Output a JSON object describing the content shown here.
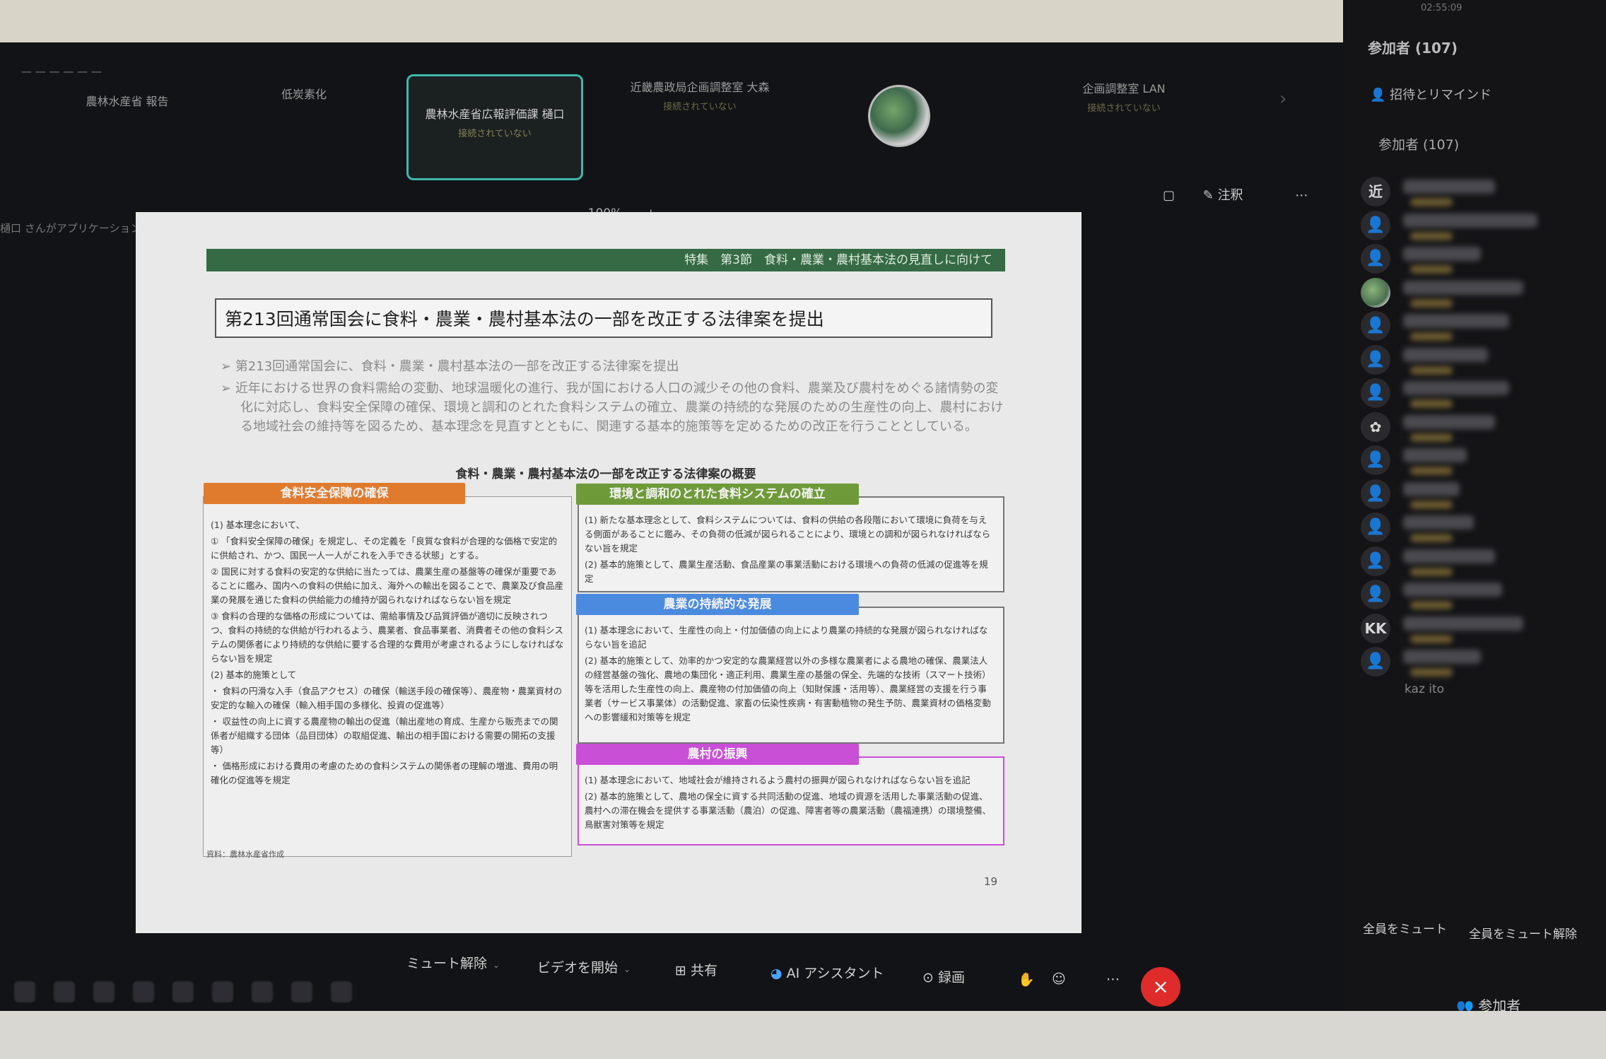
{
  "clock": "02:55:09",
  "gallery": {
    "tiles": [
      {
        "name": "農林水産省 報告",
        "sub": "",
        "active": false
      },
      {
        "name": "低炭素化",
        "sub": "",
        "active": false
      },
      {
        "name": "農林水産省広報評価課 樋口",
        "sub": "接続されていない",
        "active": true
      },
      {
        "name": "近畿農政局企画調整室 大森",
        "sub": "接続されていない",
        "active": false
      },
      {
        "name": "企画調整室 LAN",
        "sub": "接続されていない",
        "active": false
      }
    ]
  },
  "share": {
    "note": "樋口 さんがアプリケーションを共有しています",
    "zoom": "100%",
    "zoom_minus": "−",
    "zoom_plus": "+",
    "annotate": "注釈"
  },
  "slide": {
    "header": "特集　第3節　食料・農業・農村基本法の見直しに向けて",
    "title": "第213回通常国会に食料・農業・農村基本法の一部を改正する法律案を提出",
    "bullets": [
      "第213回通常国会に、食料・農業・農村基本法の一部を改正する法律案を提出",
      "近年における世界の食料需給の変動、地球温暖化の進行、我が国における人口の減少その他の食料、農業及び農村をめぐる諸情勢の変化に対応し、食料安全保障の確保、環境と調和のとれた食料システムの確立、農業の持続的な発展のための生産性の向上、農村における地域社会の維持等を図るため、基本理念を見直すとともに、関連する基本的施策等を定めるための改正を行うこととしている。"
    ],
    "subhead": "食料・農業・農村基本法の一部を改正する法律案の概要",
    "boxes": {
      "food_security": {
        "title": "食料安全保障の確保",
        "color": "#e07b2e",
        "items": [
          "(1) 基本理念において、",
          "① 「食料安全保障の確保」を規定し、その定義を「良質な食料が合理的な価格で安定的に供給され、かつ、国民一人一人がこれを入手できる状態」とする。",
          "② 国民に対する食料の安定的な供給に当たっては、農業生産の基盤等の確保が重要であることに鑑み、国内への食料の供給に加え、海外への輸出を図ることで、農業及び食品産業の発展を通じた食料の供給能力の維持が図られなければならない旨を規定",
          "③ 食料の合理的な価格の形成については、需給事情及び品質評価が適切に反映されつつ、食料の持続的な供給が行われるよう、農業者、食品事業者、消費者その他の食料システムの関係者により持続的な供給に要する合理的な費用が考慮されるようにしなければならない旨を規定",
          "(2) 基本的施策として",
          "・ 食料の円滑な入手（食品アクセス）の確保（輸送手段の確保等）、農産物・農業資材の安定的な輸入の確保（輸入相手国の多様化、投資の促進等）",
          "・ 収益性の向上に資する農産物の輸出の促進（輸出産地の育成、生産から販売までの関係者が組織する団体（品目団体）の取組促進、輸出の相手国における需要の開拓の支援等）",
          "・ 価格形成における費用の考慮のための食料システムの関係者の理解の増進、費用の明確化の促進等を規定"
        ]
      },
      "environment": {
        "title": "環境と調和のとれた食料システムの確立",
        "color": "#6f9a3a",
        "items": [
          "(1) 新たな基本理念として、食料システムについては、食料の供給の各段階において環境に負荷を与える側面があることに鑑み、その負荷の低減が図られることにより、環境との調和が図られなければならない旨を規定",
          "(2) 基本的施策として、農業生産活動、食品産業の事業活動における環境への負荷の低減の促進等を規定"
        ]
      },
      "sustainable": {
        "title": "農業の持続的な発展",
        "color": "#4a8be0",
        "items": [
          "(1) 基本理念において、生産性の向上・付加価値の向上により農業の持続的な発展が図られなければならない旨を追記",
          "(2) 基本的施策として、効率的かつ安定的な農業経営以外の多様な農業者による農地の確保、農業法人の経営基盤の強化、農地の集団化・適正利用、農業生産の基盤の保全、先端的な技術（スマート技術）等を活用した生産性の向上、農産物の付加価値の向上（知財保護・活用等）、農業経営の支援を行う事業者（サービス事業体）の活動促進、家畜の伝染性疾病・有害動植物の発生予防、農業資材の価格変動への影響緩和対策等を規定"
        ]
      },
      "rural": {
        "title": "農村の振興",
        "color": "#c94fd6",
        "items": [
          "(1) 基本理念において、地域社会が維持されるよう農村の振興が図られなければならない旨を追記",
          "(2) 基本的施策として、農地の保全に資する共同活動の促進、地域の資源を活用した事業活動の促進、農村への滞在機会を提供する事業活動（農泊）の促進、障害者等の農業活動（農福連携）の環境整備、鳥獣害対策等を規定"
        ]
      }
    },
    "source": "資料：農林水産省作成",
    "page": "19"
  },
  "participants_panel": {
    "title": "参加者 (107)",
    "invite": "招待とリマインド",
    "section": "参加者 (107)",
    "avatars": [
      {
        "kind": "text",
        "label": "近"
      },
      {
        "kind": "person",
        "label": "👤"
      },
      {
        "kind": "person",
        "label": "👤"
      },
      {
        "kind": "photo",
        "label": ""
      },
      {
        "kind": "person",
        "label": "👤"
      },
      {
        "kind": "person",
        "label": "👤"
      },
      {
        "kind": "person",
        "label": "👤"
      },
      {
        "kind": "text",
        "label": "✿"
      },
      {
        "kind": "person",
        "label": "👤"
      },
      {
        "kind": "person",
        "label": "👤"
      },
      {
        "kind": "person",
        "label": "👤"
      },
      {
        "kind": "person",
        "label": "👤"
      },
      {
        "kind": "person",
        "label": "👤"
      },
      {
        "kind": "text",
        "label": "KK"
      },
      {
        "kind": "person",
        "label": "👤"
      }
    ],
    "last_name": "kaz ito",
    "mute_all": "全員をミュート",
    "unmute_all": "全員をミュート解除"
  },
  "toolbar": {
    "unmute": "ミュート解除",
    "video": "ビデオを開始",
    "share": "共有",
    "ai": "AI アシスタント",
    "record": "録画",
    "end": "×",
    "participants": "参加者"
  },
  "colors": {
    "accent_teal": "#3fb8ae",
    "end_red": "#e02b2b",
    "slide_header_green": "#356a44"
  }
}
